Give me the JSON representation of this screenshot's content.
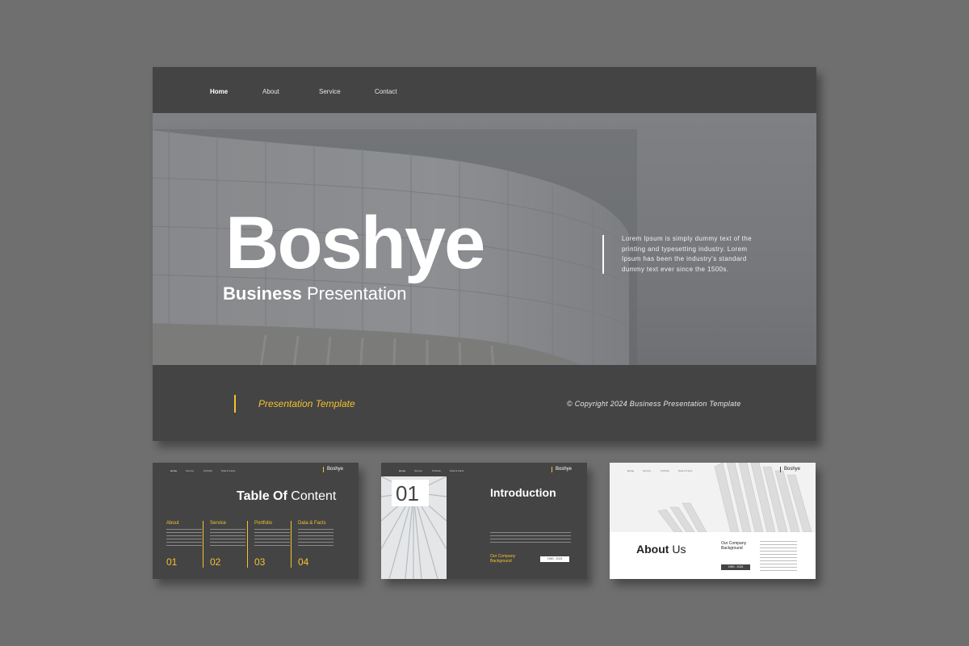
{
  "main": {
    "nav": [
      "Home",
      "About",
      "Service",
      "Contact"
    ],
    "title": "Boshye",
    "subtitle_bold": "Business",
    "subtitle_rest": "Presentation",
    "description": "Lorem Ipsum is simply dummy text of the printing and typesetting industry. Lorem Ipsum has been the industry's standard dummy text ever since the 1500s.",
    "template_label": "Presentation Template",
    "copyright": "© Copyright 2024 Business Presentation Template"
  },
  "brand": "Boshye",
  "thumb_nav": [
    "Home",
    "Service",
    "Portfolio",
    "Data & Facts"
  ],
  "toc": {
    "title_bold": "Table Of",
    "title_rest": "Content",
    "items": [
      {
        "label": "About",
        "num": "01"
      },
      {
        "label": "Service",
        "num": "02"
      },
      {
        "label": "Portfolio",
        "num": "03"
      },
      {
        "label": "Data & Facts",
        "num": "04"
      }
    ]
  },
  "intro": {
    "number": "01",
    "title": "Introduction",
    "background": "Our Company Background",
    "years": "1990 - 2024"
  },
  "about": {
    "title_bold": "About",
    "title_rest": "Us",
    "background": "Our Company Background",
    "years": "1990 - 2024"
  },
  "colors": {
    "slide": "#444444",
    "accent": "#f2c230",
    "page_bg": "#6f6f6f"
  }
}
